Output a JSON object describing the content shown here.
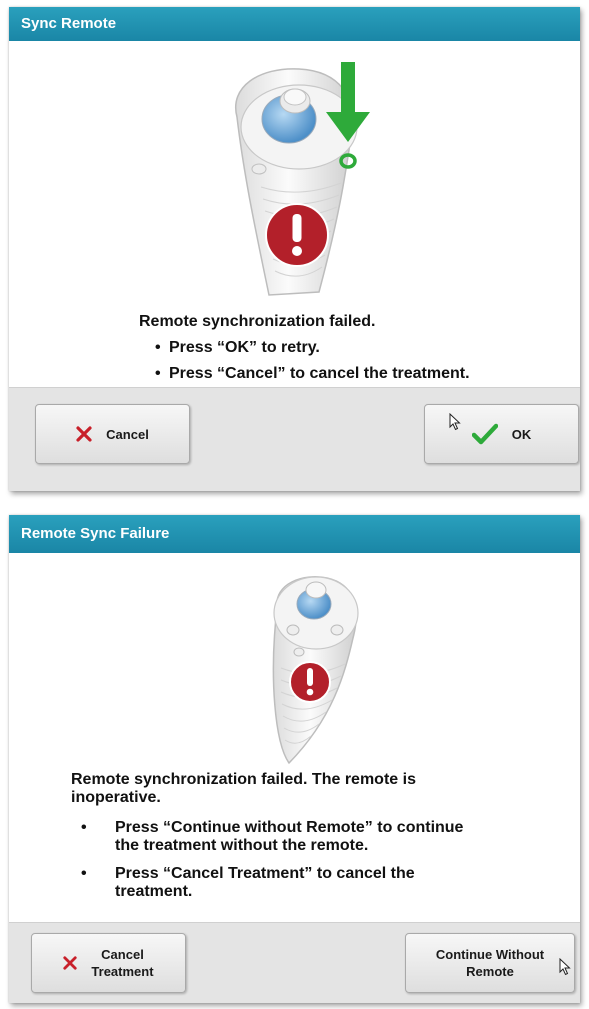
{
  "dialogs": [
    {
      "title": "Sync Remote",
      "message": "Remote synchronization failed.",
      "bullets": [
        "Press “OK” to retry.",
        "Press “Cancel” to cancel the treatment."
      ],
      "buttons": {
        "cancel": "Cancel",
        "ok": "OK"
      }
    },
    {
      "title": "Remote Sync Failure",
      "message_line1": "Remote synchronization failed.  The remote is",
      "message_line2": "inoperative.",
      "bullets": [
        {
          "line1": "Press “Continue without Remote” to continue",
          "line2": "the treatment without the remote."
        },
        {
          "line1": "Press “Cancel Treatment” to cancel the",
          "line2": "treatment."
        }
      ],
      "buttons": {
        "cancel_line1": "Cancel",
        "cancel_line2": "Treatment",
        "continue_line1": "Continue Without",
        "continue_line2": "Remote"
      }
    }
  ],
  "colors": {
    "title_bar": "#1f93b3",
    "footer": "#e4e4e4",
    "cancel_x": "#c8202a",
    "ok_check": "#2eaa3a",
    "alert": "#b3202a",
    "arrow": "#2eaa3a"
  },
  "icons": {
    "cancel": "x-icon",
    "ok": "checkmark-icon",
    "alert": "exclamation-icon",
    "arrow": "down-arrow-icon",
    "cursor": "mouse-pointer-icon"
  }
}
